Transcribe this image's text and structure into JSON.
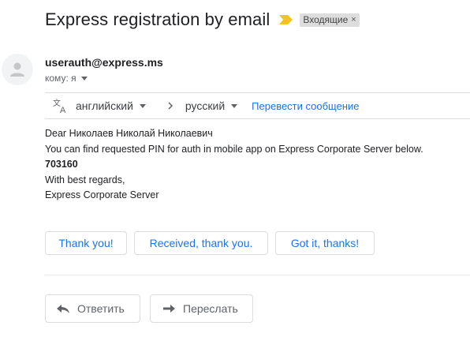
{
  "email": {
    "subject": "Express registration by email",
    "label": "Входящие",
    "label_close": "×",
    "sender": "userauth@express.ms",
    "recipient": "кому: я",
    "icons": {
      "importance": "importance-marker-icon",
      "avatar": "person-icon"
    }
  },
  "translate": {
    "source_lang": "английский",
    "target_lang": "русский",
    "link": "Перевести сообщение",
    "icons": {
      "translate": "translate-icon",
      "arrow": "chevron-right-icon",
      "dropdown": "caret-down-icon"
    }
  },
  "body": {
    "line1": "Dear Николаев Николай Николаевич",
    "line2": "You can find requested PIN for auth in mobile app on Express Corporate Server below.",
    "pin": "703160",
    "line4": "With best regards,",
    "line5": "Express Corporate Server"
  },
  "smart_replies": [
    "Thank you!",
    "Received, thank you.",
    "Got it, thanks!"
  ],
  "actions": {
    "reply": "Ответить",
    "forward": "Переслать",
    "icons": {
      "reply": "reply-icon",
      "forward": "forward-icon"
    }
  },
  "colors": {
    "link": "#1a73e8",
    "importance": "#f6c026",
    "chip_bg": "#dddddd"
  }
}
